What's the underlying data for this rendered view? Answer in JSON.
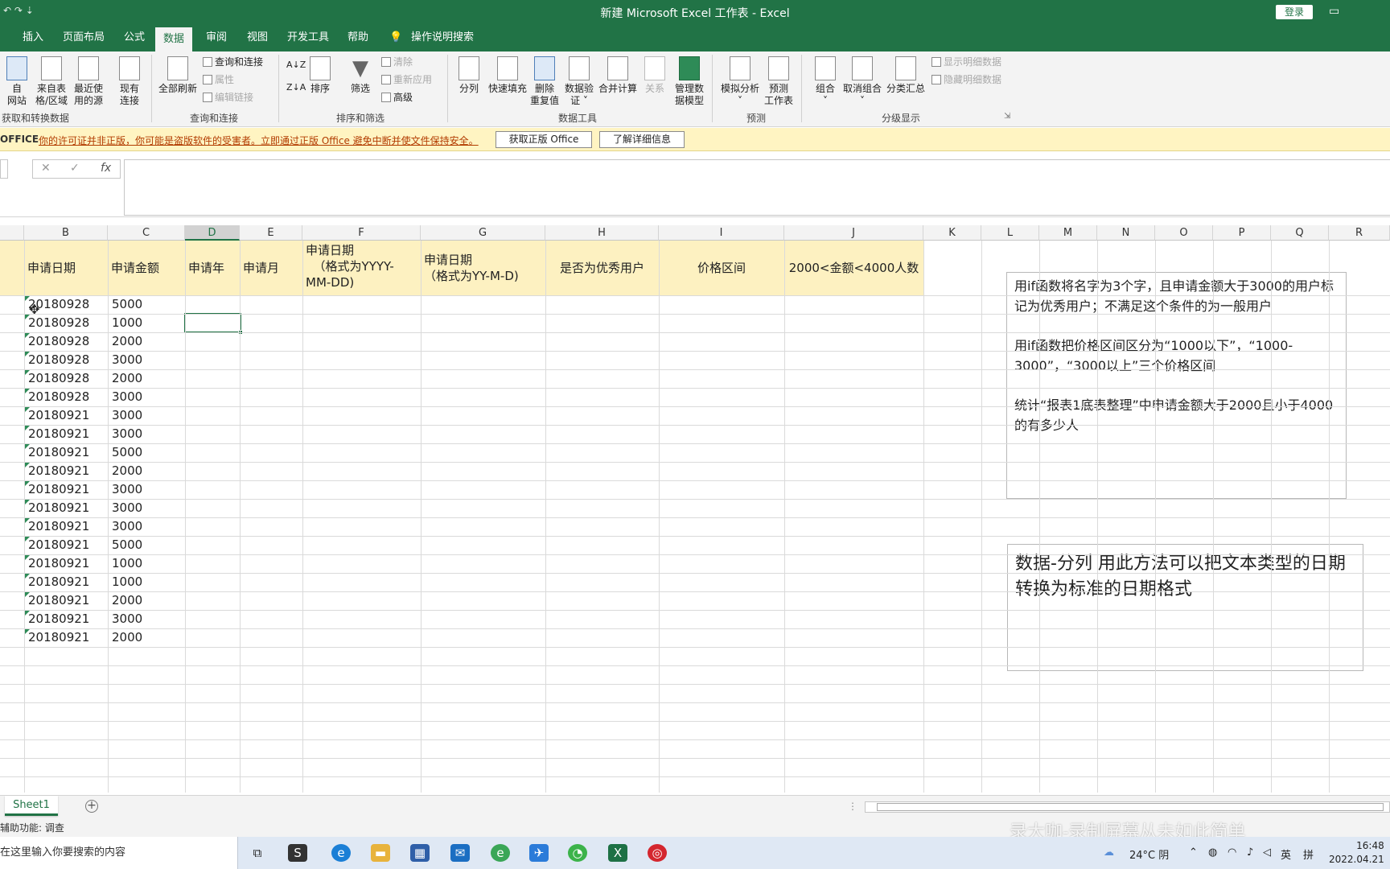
{
  "titlebar": {
    "qat": "↶ ↷ ⇣",
    "title": "新建 Microsoft Excel 工作表 - Excel",
    "login": "登录",
    "restore_icon": "▭"
  },
  "tabs": [
    "插入",
    "页面布局",
    "公式",
    "数据",
    "审阅",
    "视图",
    "开发工具",
    "帮助",
    "操作说明搜索"
  ],
  "ribbon": {
    "get_data": {
      "btn1": "自\n网站",
      "btn2": "来自表\n格/区域",
      "btn3": "最近使\n用的源",
      "btn4": "现有\n连接",
      "label": "获取和转换数据"
    },
    "queries": {
      "refresh": "全部刷新",
      "queries_conn": "查询和连接",
      "props": "属性",
      "edit_links": "编辑链接",
      "label": "查询和连接"
    },
    "sort_filter": {
      "sort_asc": "A↓Z",
      "sort_desc": "Z↓A",
      "sort": "排序",
      "filter": "筛选",
      "clear": "清除",
      "reapply": "重新应用",
      "advanced": "高级",
      "label": "排序和筛选"
    },
    "data_tools": {
      "split": "分列",
      "flash_fill": "快速填充",
      "remove_dup": "删除\n重复值",
      "validate": "数据验\n证 ˅",
      "consolidate": "合并计算",
      "relations": "关系",
      "model": "管理数\n据模型",
      "label": "数据工具"
    },
    "forecast": {
      "whatif": "模拟分析\n˅",
      "sheet": "预测\n工作表",
      "label": "预测"
    },
    "outline": {
      "group": "组合\n˅",
      "ungroup": "取消组合\n˅",
      "subtotal": "分类汇总",
      "show_detail": "显示明细数据",
      "hide_detail": "隐藏明细数据",
      "label": "分级显示"
    }
  },
  "warning": {
    "title": "OFFICE",
    "message": "你的许可证并非正版，你可能是盗版软件的受害者。立即通过正版 Office 避免中断并使文件保持安全。",
    "btn_genuine": "获取正版 Office",
    "btn_learn": "了解详细信息"
  },
  "formula_bar": {
    "cancel": "✕",
    "enter": "✓",
    "fx": "fx",
    "value": ""
  },
  "columns": [
    "B",
    "C",
    "D",
    "E",
    "F",
    "G",
    "H",
    "I",
    "J",
    "K",
    "L",
    "M",
    "N",
    "O",
    "P",
    "Q",
    "R"
  ],
  "headers": {
    "B": "申请日期",
    "C": "申请金额",
    "D": "申请年",
    "E": "申请月",
    "F": "申请日期\n  （格式为YYYY-\nMM-DD)",
    "G": "申请日期\n（格式为YY-M-D)",
    "H": "是否为优秀用户",
    "I": "价格区间",
    "J": "2000<金额<4000人数"
  },
  "rows": [
    [
      "20180928",
      "5000"
    ],
    [
      "20180928",
      "1000"
    ],
    [
      "20180928",
      "2000"
    ],
    [
      "20180928",
      "3000"
    ],
    [
      "20180928",
      "2000"
    ],
    [
      "20180928",
      "3000"
    ],
    [
      "20180921",
      "3000"
    ],
    [
      "20180921",
      "3000"
    ],
    [
      "20180921",
      "5000"
    ],
    [
      "20180921",
      "2000"
    ],
    [
      "20180921",
      "3000"
    ],
    [
      "20180921",
      "3000"
    ],
    [
      "20180921",
      "3000"
    ],
    [
      "20180921",
      "5000"
    ],
    [
      "20180921",
      "1000"
    ],
    [
      "20180921",
      "1000"
    ],
    [
      "20180921",
      "2000"
    ],
    [
      "20180921",
      "3000"
    ],
    [
      "20180921",
      "2000"
    ]
  ],
  "note1": {
    "p1": "用if函数将名字为3个字，且申请金额大于3000的用户标记为优秀用户；不满足这个条件的为一般用户",
    "p2": "用if函数把价格区间区分为“1000以下”，“1000-3000”，“3000以上”三个价格区间",
    "p3": "统计“报表1底表整理”中申请金额大于2000且小于4000的有多少人"
  },
  "note2": {
    "text": "数据-分列 用此方法可以把文本类型的日期转换为标准的日期格式"
  },
  "sheet": {
    "tab": "Sheet1",
    "add": "+"
  },
  "status": {
    "text": "辅助功能: 调查",
    "watermark": "录大咖-录制屏幕从未如此简单"
  },
  "taskbar": {
    "search": "在这里输入你要搜索的内容",
    "temp": "24°C 阴",
    "ime1": "英",
    "ime2": "拼",
    "time": "16:48",
    "date": "2022.04.21"
  }
}
